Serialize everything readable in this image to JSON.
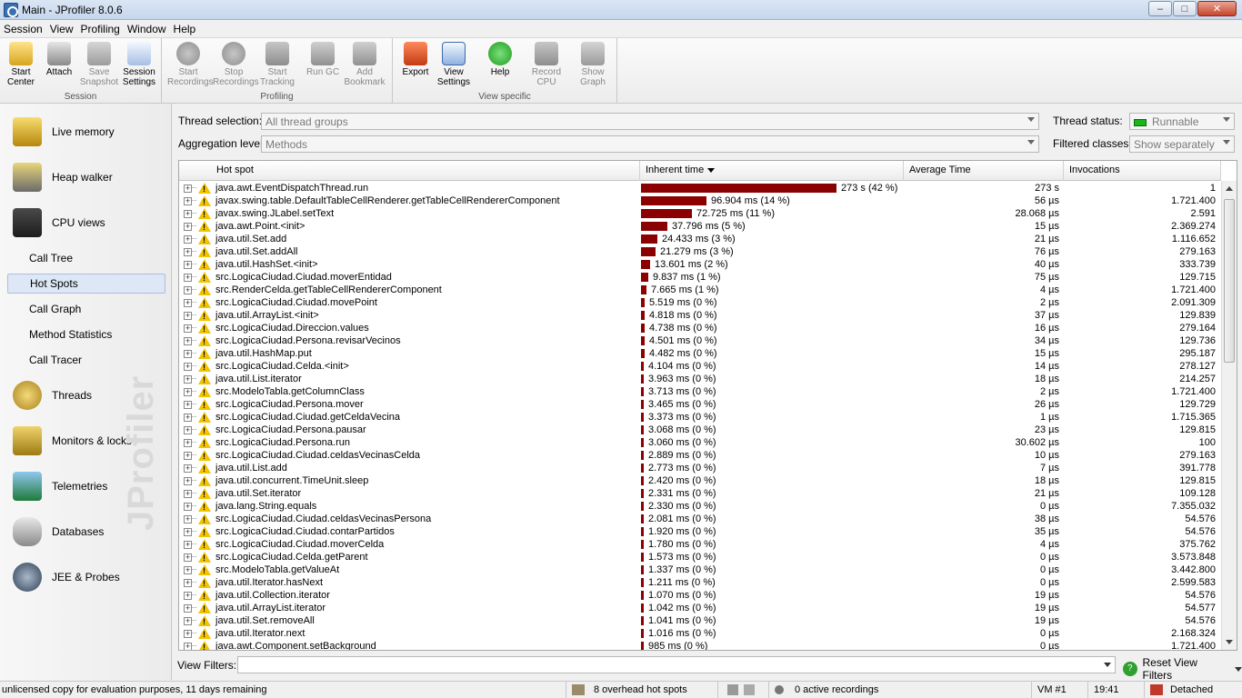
{
  "window": {
    "title": "Main - JProfiler 8.0.6"
  },
  "menu": [
    "Session",
    "View",
    "Profiling",
    "Window",
    "Help"
  ],
  "toolbar": {
    "groups": [
      {
        "label": "Session",
        "buttons": [
          "Start Center",
          "Attach",
          "Save Snapshot",
          "Session Settings"
        ]
      },
      {
        "label": "Profiling",
        "buttons": [
          "Start Recordings",
          "Stop Recordings",
          "Start Tracking",
          "Run GC",
          "Add Bookmark"
        ]
      },
      {
        "label": "View specific",
        "buttons": [
          "Export",
          "View Settings",
          "Help",
          "Record CPU",
          "Show Graph"
        ]
      }
    ]
  },
  "sidebar": {
    "items": [
      {
        "label": "Live memory",
        "icon": "live-memory-icon"
      },
      {
        "label": "Heap walker",
        "icon": "heap-walker-icon"
      },
      {
        "label": "CPU views",
        "icon": "cpu-views-icon"
      },
      {
        "label": "Call Tree"
      },
      {
        "label": "Hot Spots"
      },
      {
        "label": "Call Graph"
      },
      {
        "label": "Method Statistics"
      },
      {
        "label": "Call Tracer"
      },
      {
        "label": "Threads",
        "icon": "threads-icon"
      },
      {
        "label": "Monitors & locks",
        "icon": "monitors-locks-icon"
      },
      {
        "label": "Telemetries",
        "icon": "telemetries-icon"
      },
      {
        "label": "Databases",
        "icon": "databases-icon"
      },
      {
        "label": "JEE & Probes",
        "icon": "jee-probes-icon"
      }
    ],
    "watermark": "JProfiler"
  },
  "filters": {
    "thread_selection_label": "Thread selection:",
    "thread_selection_value": "All thread groups",
    "aggregation_label": "Aggregation level:",
    "aggregation_value": "Methods",
    "thread_status_label": "Thread status:",
    "thread_status_value": "Runnable",
    "filtered_classes_label": "Filtered classes:",
    "filtered_classes_value": "Show separately"
  },
  "table": {
    "columns": [
      "Hot spot",
      "Inherent time",
      "Average Time",
      "Invocations"
    ],
    "rows": [
      {
        "name": "java.awt.EventDispatchThread.run",
        "time": "273 s (42 %)",
        "pct": 42,
        "avg": "273 s",
        "inv": "1"
      },
      {
        "name": "javax.swing.table.DefaultTableCellRenderer.getTableCellRendererComponent",
        "time": "96.904 ms (14 %)",
        "pct": 14,
        "avg": "56 µs",
        "inv": "1.721.400"
      },
      {
        "name": "javax.swing.JLabel.setText",
        "time": "72.725 ms (11 %)",
        "pct": 11,
        "avg": "28.068 µs",
        "inv": "2.591"
      },
      {
        "name": "java.awt.Point.<init>",
        "time": "37.796 ms (5 %)",
        "pct": 5.7,
        "avg": "15 µs",
        "inv": "2.369.274"
      },
      {
        "name": "java.util.Set.add",
        "time": "24.433 ms (3 %)",
        "pct": 3.6,
        "avg": "21 µs",
        "inv": "1.116.652"
      },
      {
        "name": "java.util.Set.addAll",
        "time": "21.279 ms (3 %)",
        "pct": 3.2,
        "avg": "76 µs",
        "inv": "279.163"
      },
      {
        "name": "java.util.HashSet.<init>",
        "time": "13.601 ms (2 %)",
        "pct": 2.0,
        "avg": "40 µs",
        "inv": "333.739"
      },
      {
        "name": "src.LogicaCiudad.Ciudad.moverEntidad",
        "time": "9.837 ms (1 %)",
        "pct": 1.5,
        "avg": "75 µs",
        "inv": "129.715"
      },
      {
        "name": "src.RenderCelda.getTableCellRendererComponent",
        "time": "7.665 ms (1 %)",
        "pct": 1.1,
        "avg": "4 µs",
        "inv": "1.721.400"
      },
      {
        "name": "src.LogicaCiudad.Ciudad.movePoint",
        "time": "5.519 ms (0 %)",
        "pct": 0.8,
        "avg": "2 µs",
        "inv": "2.091.309"
      },
      {
        "name": "java.util.ArrayList.<init>",
        "time": "4.818 ms (0 %)",
        "pct": 0.7,
        "avg": "37 µs",
        "inv": "129.839"
      },
      {
        "name": "src.LogicaCiudad.Direccion.values",
        "time": "4.738 ms (0 %)",
        "pct": 0.7,
        "avg": "16 µs",
        "inv": "279.164"
      },
      {
        "name": "src.LogicaCiudad.Persona.revisarVecinos",
        "time": "4.501 ms (0 %)",
        "pct": 0.7,
        "avg": "34 µs",
        "inv": "129.736"
      },
      {
        "name": "java.util.HashMap.put",
        "time": "4.482 ms (0 %)",
        "pct": 0.7,
        "avg": "15 µs",
        "inv": "295.187"
      },
      {
        "name": "src.LogicaCiudad.Celda.<init>",
        "time": "4.104 ms (0 %)",
        "pct": 0.6,
        "avg": "14 µs",
        "inv": "278.127"
      },
      {
        "name": "java.util.List.iterator",
        "time": "3.963 ms (0 %)",
        "pct": 0.6,
        "avg": "18 µs",
        "inv": "214.257"
      },
      {
        "name": "src.ModeloTabla.getColumnClass",
        "time": "3.713 ms (0 %)",
        "pct": 0.5,
        "avg": "2 µs",
        "inv": "1.721.400"
      },
      {
        "name": "src.LogicaCiudad.Persona.mover",
        "time": "3.465 ms (0 %)",
        "pct": 0.5,
        "avg": "26 µs",
        "inv": "129.729"
      },
      {
        "name": "src.LogicaCiudad.Ciudad.getCeldaVecina",
        "time": "3.373 ms (0 %)",
        "pct": 0.5,
        "avg": "1 µs",
        "inv": "1.715.365"
      },
      {
        "name": "src.LogicaCiudad.Persona.pausar",
        "time": "3.068 ms (0 %)",
        "pct": 0.5,
        "avg": "23 µs",
        "inv": "129.815"
      },
      {
        "name": "src.LogicaCiudad.Persona.run",
        "time": "3.060 ms (0 %)",
        "pct": 0.5,
        "avg": "30.602 µs",
        "inv": "100"
      },
      {
        "name": "src.LogicaCiudad.Ciudad.celdasVecinasCelda",
        "time": "2.889 ms (0 %)",
        "pct": 0.4,
        "avg": "10 µs",
        "inv": "279.163"
      },
      {
        "name": "java.util.List.add",
        "time": "2.773 ms (0 %)",
        "pct": 0.4,
        "avg": "7 µs",
        "inv": "391.778"
      },
      {
        "name": "java.util.concurrent.TimeUnit.sleep",
        "time": "2.420 ms (0 %)",
        "pct": 0.4,
        "avg": "18 µs",
        "inv": "129.815"
      },
      {
        "name": "java.util.Set.iterator",
        "time": "2.331 ms (0 %)",
        "pct": 0.3,
        "avg": "21 µs",
        "inv": "109.128"
      },
      {
        "name": "java.lang.String.equals",
        "time": "2.330 ms (0 %)",
        "pct": 0.3,
        "avg": "0 µs",
        "inv": "7.355.032"
      },
      {
        "name": "src.LogicaCiudad.Ciudad.celdasVecinasPersona",
        "time": "2.081 ms (0 %)",
        "pct": 0.3,
        "avg": "38 µs",
        "inv": "54.576"
      },
      {
        "name": "src.LogicaCiudad.Ciudad.contarPartidos",
        "time": "1.920 ms (0 %)",
        "pct": 0.3,
        "avg": "35 µs",
        "inv": "54.576"
      },
      {
        "name": "src.LogicaCiudad.Ciudad.moverCelda",
        "time": "1.780 ms (0 %)",
        "pct": 0.3,
        "avg": "4 µs",
        "inv": "375.762"
      },
      {
        "name": "src.LogicaCiudad.Celda.getParent",
        "time": "1.573 ms (0 %)",
        "pct": 0.2,
        "avg": "0 µs",
        "inv": "3.573.848"
      },
      {
        "name": "src.ModeloTabla.getValueAt",
        "time": "1.337 ms (0 %)",
        "pct": 0.2,
        "avg": "0 µs",
        "inv": "3.442.800"
      },
      {
        "name": "java.util.Iterator.hasNext",
        "time": "1.211 ms (0 %)",
        "pct": 0.2,
        "avg": "0 µs",
        "inv": "2.599.583"
      },
      {
        "name": "java.util.Collection.iterator",
        "time": "1.070 ms (0 %)",
        "pct": 0.2,
        "avg": "19 µs",
        "inv": "54.576"
      },
      {
        "name": "java.util.ArrayList.iterator",
        "time": "1.042 ms (0 %)",
        "pct": 0.2,
        "avg": "19 µs",
        "inv": "54.577"
      },
      {
        "name": "java.util.Set.removeAll",
        "time": "1.041 ms (0 %)",
        "pct": 0.2,
        "avg": "19 µs",
        "inv": "54.576"
      },
      {
        "name": "java.util.Iterator.next",
        "time": "1.016 ms (0 %)",
        "pct": 0.2,
        "avg": "0 µs",
        "inv": "2.168.324"
      },
      {
        "name": "java.awt.Component.setBackground",
        "time": "985 ms (0 %)",
        "pct": 0.1,
        "avg": "0 µs",
        "inv": "1.721.400"
      }
    ]
  },
  "view_filters": {
    "label": "View Filters:",
    "value": "",
    "reset_label": "Reset View Filters"
  },
  "status": {
    "license": "unlicensed copy for evaluation purposes, 11 days remaining",
    "overhead": "8 overhead hot spots",
    "recordings": "0 active recordings",
    "vm": "VM #1",
    "clock": "19:41",
    "mode": "Detached"
  },
  "colors": {
    "bar": "#8b0000",
    "runnable": "#19b519",
    "selected": "#dde7f6"
  }
}
